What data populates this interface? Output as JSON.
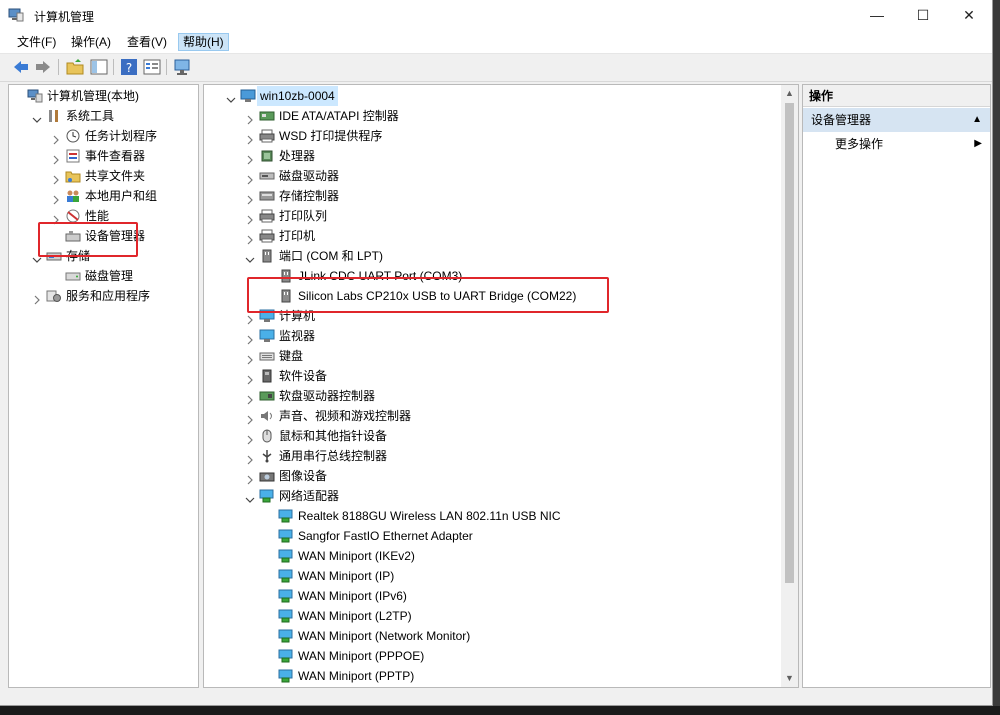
{
  "window": {
    "title": "计算机管理",
    "controls": {
      "minimize": "—",
      "maximize": "☐",
      "close": "✕"
    }
  },
  "menu": [
    "文件(F)",
    "操作(A)",
    "查看(V)",
    "帮助(H)"
  ],
  "left_tree": [
    {
      "label": "计算机管理(本地)",
      "icon": "computer-management-icon",
      "indent": 0,
      "toggle": "none"
    },
    {
      "label": "系统工具",
      "icon": "tools-icon",
      "indent": 1,
      "toggle": "open"
    },
    {
      "label": "任务计划程序",
      "icon": "clock-icon",
      "indent": 2,
      "toggle": "closed"
    },
    {
      "label": "事件查看器",
      "icon": "event-viewer-icon",
      "indent": 2,
      "toggle": "closed"
    },
    {
      "label": "共享文件夹",
      "icon": "shared-folder-icon",
      "indent": 2,
      "toggle": "closed"
    },
    {
      "label": "本地用户和组",
      "icon": "users-icon",
      "indent": 2,
      "toggle": "closed"
    },
    {
      "label": "性能",
      "icon": "performance-icon",
      "indent": 2,
      "toggle": "closed"
    },
    {
      "label": "设备管理器",
      "icon": "device-manager-icon",
      "indent": 2,
      "toggle": "none"
    },
    {
      "label": "存储",
      "icon": "storage-icon",
      "indent": 1,
      "toggle": "open"
    },
    {
      "label": "磁盘管理",
      "icon": "disk-management-icon",
      "indent": 2,
      "toggle": "none"
    },
    {
      "label": "服务和应用程序",
      "icon": "services-icon",
      "indent": 1,
      "toggle": "closed"
    }
  ],
  "device_tree": [
    {
      "label": "win10zb-0004",
      "icon": "computer-icon",
      "indent": 0,
      "toggle": "open",
      "selected": true
    },
    {
      "label": "IDE ATA/ATAPI 控制器",
      "icon": "ide-controller-icon",
      "indent": 1,
      "toggle": "closed"
    },
    {
      "label": "WSD 打印提供程序",
      "icon": "printer-icon",
      "indent": 1,
      "toggle": "closed"
    },
    {
      "label": "处理器",
      "icon": "processor-icon",
      "indent": 1,
      "toggle": "closed"
    },
    {
      "label": "磁盘驱动器",
      "icon": "disk-drive-icon",
      "indent": 1,
      "toggle": "closed"
    },
    {
      "label": "存储控制器",
      "icon": "storage-controller-icon",
      "indent": 1,
      "toggle": "closed"
    },
    {
      "label": "打印队列",
      "icon": "printer-icon",
      "indent": 1,
      "toggle": "closed"
    },
    {
      "label": "打印机",
      "icon": "printer-icon",
      "indent": 1,
      "toggle": "closed"
    },
    {
      "label": "端口 (COM 和 LPT)",
      "icon": "port-icon",
      "indent": 1,
      "toggle": "open"
    },
    {
      "label": "JLink CDC UART Port (COM3)",
      "icon": "port-icon",
      "indent": 2,
      "toggle": "none"
    },
    {
      "label": "Silicon Labs CP210x USB to UART Bridge (COM22)",
      "icon": "port-icon",
      "indent": 2,
      "toggle": "none"
    },
    {
      "label": "计算机",
      "icon": "monitor-icon",
      "indent": 1,
      "toggle": "closed"
    },
    {
      "label": "监视器",
      "icon": "monitor-icon",
      "indent": 1,
      "toggle": "closed"
    },
    {
      "label": "键盘",
      "icon": "keyboard-icon",
      "indent": 1,
      "toggle": "closed"
    },
    {
      "label": "软件设备",
      "icon": "software-device-icon",
      "indent": 1,
      "toggle": "closed"
    },
    {
      "label": "软盘驱动器控制器",
      "icon": "floppy-controller-icon",
      "indent": 1,
      "toggle": "closed"
    },
    {
      "label": "声音、视频和游戏控制器",
      "icon": "speaker-icon",
      "indent": 1,
      "toggle": "closed"
    },
    {
      "label": "鼠标和其他指针设备",
      "icon": "mouse-icon",
      "indent": 1,
      "toggle": "closed"
    },
    {
      "label": "通用串行总线控制器",
      "icon": "usb-icon",
      "indent": 1,
      "toggle": "closed"
    },
    {
      "label": "图像设备",
      "icon": "camera-icon",
      "indent": 1,
      "toggle": "closed"
    },
    {
      "label": "网络适配器",
      "icon": "network-adapter-icon",
      "indent": 1,
      "toggle": "open"
    },
    {
      "label": "Realtek 8188GU Wireless LAN 802.11n USB NIC",
      "icon": "network-adapter-icon",
      "indent": 2,
      "toggle": "none"
    },
    {
      "label": "Sangfor FastIO Ethernet Adapter",
      "icon": "network-adapter-icon",
      "indent": 2,
      "toggle": "none"
    },
    {
      "label": "WAN Miniport (IKEv2)",
      "icon": "network-adapter-icon",
      "indent": 2,
      "toggle": "none"
    },
    {
      "label": "WAN Miniport (IP)",
      "icon": "network-adapter-icon",
      "indent": 2,
      "toggle": "none"
    },
    {
      "label": "WAN Miniport (IPv6)",
      "icon": "network-adapter-icon",
      "indent": 2,
      "toggle": "none"
    },
    {
      "label": "WAN Miniport (L2TP)",
      "icon": "network-adapter-icon",
      "indent": 2,
      "toggle": "none"
    },
    {
      "label": "WAN Miniport (Network Monitor)",
      "icon": "network-adapter-icon",
      "indent": 2,
      "toggle": "none"
    },
    {
      "label": "WAN Miniport (PPPOE)",
      "icon": "network-adapter-icon",
      "indent": 2,
      "toggle": "none"
    },
    {
      "label": "WAN Miniport (PPTP)",
      "icon": "network-adapter-icon",
      "indent": 2,
      "toggle": "none"
    }
  ],
  "actions": {
    "header": "操作",
    "group": "设备管理器",
    "more": "更多操作"
  },
  "colors": {
    "highlight_box": "#e0262b",
    "selection": "#cce8ff",
    "action_group_bg": "#d6e4f2"
  }
}
